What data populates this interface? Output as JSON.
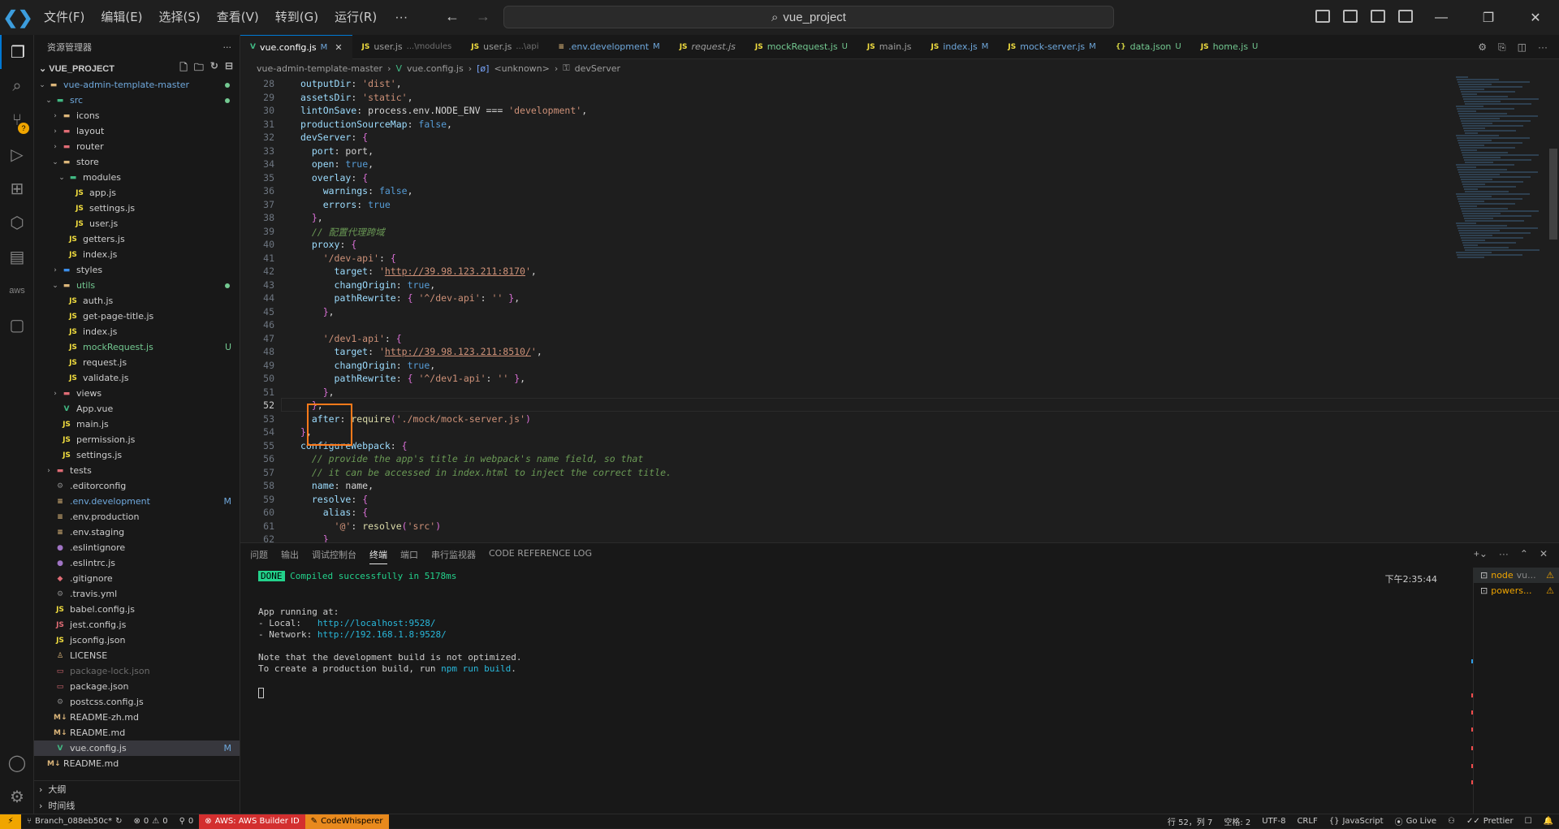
{
  "menu": {
    "items": [
      "文件(F)",
      "编辑(E)",
      "选择(S)",
      "查看(V)",
      "转到(G)",
      "运行(R)"
    ],
    "more": "···"
  },
  "search": {
    "text": "vue_project"
  },
  "window": {
    "min": "—",
    "max": "❐",
    "close": "✕"
  },
  "explorer": {
    "title": "资源管理器",
    "more": "···",
    "project": "VUE_PROJECT",
    "rows": [
      {
        "depth": 1,
        "chev": "⌄",
        "icon": "▬",
        "ic": "fold",
        "name": "vue-admin-template-master",
        "cls": "git-m",
        "stat": "dot"
      },
      {
        "depth": 2,
        "chev": "⌄",
        "icon": "▬",
        "ic": "vue",
        "name": "src",
        "cls": "git-m",
        "stat": "dot"
      },
      {
        "depth": 3,
        "chev": "›",
        "icon": "▬",
        "ic": "fold",
        "name": "icons",
        "cls": "",
        "stat": ""
      },
      {
        "depth": 3,
        "chev": "›",
        "icon": "▬",
        "ic": "red",
        "name": "layout",
        "cls": "",
        "stat": ""
      },
      {
        "depth": 3,
        "chev": "›",
        "icon": "▬",
        "ic": "red",
        "name": "router",
        "cls": "",
        "stat": ""
      },
      {
        "depth": 3,
        "chev": "⌄",
        "icon": "▬",
        "ic": "fold",
        "name": "store",
        "cls": "",
        "stat": ""
      },
      {
        "depth": 4,
        "chev": "⌄",
        "icon": "▬",
        "ic": "vue",
        "name": "modules",
        "cls": "",
        "stat": ""
      },
      {
        "depth": 5,
        "chev": "",
        "icon": "JS",
        "ic": "js",
        "name": "app.js",
        "cls": "",
        "stat": ""
      },
      {
        "depth": 5,
        "chev": "",
        "icon": "JS",
        "ic": "js",
        "name": "settings.js",
        "cls": "",
        "stat": ""
      },
      {
        "depth": 5,
        "chev": "",
        "icon": "JS",
        "ic": "js",
        "name": "user.js",
        "cls": "",
        "stat": ""
      },
      {
        "depth": 4,
        "chev": "",
        "icon": "JS",
        "ic": "js",
        "name": "getters.js",
        "cls": "",
        "stat": ""
      },
      {
        "depth": 4,
        "chev": "",
        "icon": "JS",
        "ic": "js",
        "name": "index.js",
        "cls": "",
        "stat": ""
      },
      {
        "depth": 3,
        "chev": "›",
        "icon": "▬",
        "ic": "blue",
        "name": "styles",
        "cls": "",
        "stat": ""
      },
      {
        "depth": 3,
        "chev": "⌄",
        "icon": "▬",
        "ic": "fold",
        "name": "utils",
        "cls": "git-u",
        "stat": "dot"
      },
      {
        "depth": 4,
        "chev": "",
        "icon": "JS",
        "ic": "js",
        "name": "auth.js",
        "cls": "",
        "stat": ""
      },
      {
        "depth": 4,
        "chev": "",
        "icon": "JS",
        "ic": "js",
        "name": "get-page-title.js",
        "cls": "",
        "stat": ""
      },
      {
        "depth": 4,
        "chev": "",
        "icon": "JS",
        "ic": "js",
        "name": "index.js",
        "cls": "",
        "stat": ""
      },
      {
        "depth": 4,
        "chev": "",
        "icon": "JS",
        "ic": "js",
        "name": "mockRequest.js",
        "cls": "git-u",
        "stat": "U"
      },
      {
        "depth": 4,
        "chev": "",
        "icon": "JS",
        "ic": "js",
        "name": "request.js",
        "cls": "",
        "stat": ""
      },
      {
        "depth": 4,
        "chev": "",
        "icon": "JS",
        "ic": "js",
        "name": "validate.js",
        "cls": "",
        "stat": ""
      },
      {
        "depth": 3,
        "chev": "›",
        "icon": "▬",
        "ic": "red",
        "name": "views",
        "cls": "",
        "stat": ""
      },
      {
        "depth": 3,
        "chev": "",
        "icon": "V",
        "ic": "vue",
        "name": "App.vue",
        "cls": "",
        "stat": ""
      },
      {
        "depth": 3,
        "chev": "",
        "icon": "JS",
        "ic": "js",
        "name": "main.js",
        "cls": "",
        "stat": ""
      },
      {
        "depth": 3,
        "chev": "",
        "icon": "JS",
        "ic": "js",
        "name": "permission.js",
        "cls": "",
        "stat": ""
      },
      {
        "depth": 3,
        "chev": "",
        "icon": "JS",
        "ic": "js",
        "name": "settings.js",
        "cls": "",
        "stat": ""
      },
      {
        "depth": 2,
        "chev": "›",
        "icon": "▬",
        "ic": "red",
        "name": "tests",
        "cls": "",
        "stat": ""
      },
      {
        "depth": 2,
        "chev": "",
        "icon": "⚙",
        "ic": "gray",
        "name": ".editorconfig",
        "cls": "",
        "stat": ""
      },
      {
        "depth": 2,
        "chev": "",
        "icon": "≡",
        "ic": "fold",
        "name": ".env.development",
        "cls": "git-m",
        "stat": "M"
      },
      {
        "depth": 2,
        "chev": "",
        "icon": "≡",
        "ic": "fold",
        "name": ".env.production",
        "cls": "",
        "stat": ""
      },
      {
        "depth": 2,
        "chev": "",
        "icon": "≡",
        "ic": "fold",
        "name": ".env.staging",
        "cls": "",
        "stat": ""
      },
      {
        "depth": 2,
        "chev": "",
        "icon": "●",
        "ic": "purp",
        "name": ".eslintignore",
        "cls": "",
        "stat": ""
      },
      {
        "depth": 2,
        "chev": "",
        "icon": "●",
        "ic": "purp",
        "name": ".eslintrc.js",
        "cls": "",
        "stat": ""
      },
      {
        "depth": 2,
        "chev": "",
        "icon": "◆",
        "ic": "red",
        "name": ".gitignore",
        "cls": "",
        "stat": ""
      },
      {
        "depth": 2,
        "chev": "",
        "icon": "⚙",
        "ic": "gray",
        "name": ".travis.yml",
        "cls": "",
        "stat": ""
      },
      {
        "depth": 2,
        "chev": "",
        "icon": "JS",
        "ic": "js",
        "name": "babel.config.js",
        "cls": "",
        "stat": ""
      },
      {
        "depth": 2,
        "chev": "",
        "icon": "JS",
        "ic": "red",
        "name": "jest.config.js",
        "cls": "",
        "stat": ""
      },
      {
        "depth": 2,
        "chev": "",
        "icon": "JS",
        "ic": "js",
        "name": "jsconfig.json",
        "cls": "",
        "stat": ""
      },
      {
        "depth": 2,
        "chev": "",
        "icon": "♙",
        "ic": "fold",
        "name": "LICENSE",
        "cls": "",
        "stat": ""
      },
      {
        "depth": 2,
        "chev": "",
        "icon": "▭",
        "ic": "red",
        "name": "package-lock.json",
        "cls": "ign",
        "stat": ""
      },
      {
        "depth": 2,
        "chev": "",
        "icon": "▭",
        "ic": "red",
        "name": "package.json",
        "cls": "",
        "stat": ""
      },
      {
        "depth": 2,
        "chev": "",
        "icon": "⚙",
        "ic": "gray",
        "name": "postcss.config.js",
        "cls": "",
        "stat": ""
      },
      {
        "depth": 2,
        "chev": "",
        "icon": "M↓",
        "ic": "fold",
        "name": "README-zh.md",
        "cls": "",
        "stat": ""
      },
      {
        "depth": 2,
        "chev": "",
        "icon": "M↓",
        "ic": "fold",
        "name": "README.md",
        "cls": "",
        "stat": ""
      },
      {
        "depth": 2,
        "chev": "",
        "icon": "V",
        "ic": "vue",
        "name": "vue.config.js",
        "cls": "sel",
        "stat": "M"
      },
      {
        "depth": 1,
        "chev": "",
        "icon": "M↓",
        "ic": "fold",
        "name": "README.md",
        "cls": "",
        "stat": ""
      }
    ],
    "outline": "大纲",
    "timeline": "时间线"
  },
  "tabs": [
    {
      "icon": "V",
      "ic": "vue",
      "name": "vue.config.js",
      "desc": "",
      "st": "M",
      "active": true
    },
    {
      "icon": "JS",
      "ic": "js",
      "name": "user.js",
      "desc": "...\\modules",
      "st": "",
      "active": false
    },
    {
      "icon": "JS",
      "ic": "js",
      "name": "user.js",
      "desc": "...\\api",
      "st": "",
      "active": false
    },
    {
      "icon": "≡",
      "ic": "fold",
      "name": ".env.development",
      "desc": "",
      "st": "M",
      "active": false
    },
    {
      "icon": "JS",
      "ic": "js",
      "name": "request.js",
      "desc": "",
      "st": "",
      "active": false
    },
    {
      "icon": "JS",
      "ic": "js",
      "name": "mockRequest.js",
      "desc": "",
      "st": "U",
      "active": false
    },
    {
      "icon": "JS",
      "ic": "js",
      "name": "main.js",
      "desc": "",
      "st": "",
      "active": false
    },
    {
      "icon": "JS",
      "ic": "js",
      "name": "index.js",
      "desc": "",
      "st": "M",
      "active": false
    },
    {
      "icon": "JS",
      "ic": "js",
      "name": "mock-server.js",
      "desc": "",
      "st": "M",
      "active": false
    },
    {
      "icon": "{}",
      "ic": "json",
      "name": "data.json",
      "desc": "",
      "st": "U",
      "active": false
    },
    {
      "icon": "JS",
      "ic": "js",
      "name": "home.js",
      "desc": "",
      "st": "U",
      "active": false
    }
  ],
  "breadcrumb": [
    "vue-admin-template-master",
    "vue.config.js",
    "<unknown>",
    "devServer"
  ],
  "code": [
    {
      "n": "28",
      "t": "outputDir: 'dist',"
    },
    {
      "n": "29",
      "t": "assetsDir: 'static',"
    },
    {
      "n": "30",
      "t": "lintOnSave: process.env.NODE_ENV === 'development',"
    },
    {
      "n": "31",
      "t": "productionSourceMap: false,"
    },
    {
      "n": "32",
      "t": "devServer: {"
    },
    {
      "n": "33",
      "t": "  port: port,"
    },
    {
      "n": "34",
      "t": "  open: true,"
    },
    {
      "n": "35",
      "t": "  overlay: {"
    },
    {
      "n": "36",
      "t": "    warnings: false,"
    },
    {
      "n": "37",
      "t": "    errors: true"
    },
    {
      "n": "38",
      "t": "  },"
    },
    {
      "n": "39",
      "t": "  // 配置代理跨域"
    },
    {
      "n": "40",
      "t": "  proxy: {"
    },
    {
      "n": "41",
      "t": "    '/dev-api': {"
    },
    {
      "n": "42",
      "t": "      target: 'http://39.98.123.211:8170',"
    },
    {
      "n": "43",
      "t": "      changOrigin: true,"
    },
    {
      "n": "44",
      "t": "      pathRewrite: { '^/dev-api': '' },"
    },
    {
      "n": "45",
      "t": "    },"
    },
    {
      "n": "46",
      "t": ""
    },
    {
      "n": "47",
      "t": "    '/dev1-api': {"
    },
    {
      "n": "48",
      "t": "      target: 'http://39.98.123.211:8510/',"
    },
    {
      "n": "49",
      "t": "      changOrigin: true,"
    },
    {
      "n": "50",
      "t": "      pathRewrite: { '^/dev1-api': '' },"
    },
    {
      "n": "51",
      "t": "    },"
    },
    {
      "n": "52",
      "t": "  },"
    },
    {
      "n": "53",
      "t": "  after: require('./mock/mock-server.js')"
    },
    {
      "n": "54",
      "t": "},"
    },
    {
      "n": "55",
      "t": "configureWebpack: {"
    },
    {
      "n": "56",
      "t": "  // provide the app's title in webpack's name field, so that"
    },
    {
      "n": "57",
      "t": "  // it can be accessed in index.html to inject the correct title."
    },
    {
      "n": "58",
      "t": "  name: name,"
    },
    {
      "n": "59",
      "t": "  resolve: {"
    },
    {
      "n": "60",
      "t": "    alias: {"
    },
    {
      "n": "61",
      "t": "      '@': resolve('src')"
    },
    {
      "n": "62",
      "t": "    }"
    }
  ],
  "panel": {
    "tabs": [
      "问题",
      "输出",
      "调试控制台",
      "终端",
      "端口",
      "串行监视器",
      "CODE REFERENCE LOG"
    ],
    "time": "下午2:35:44",
    "done": "DONE",
    "compiled": "Compiled successfully in 5178ms",
    "running": "App running at:",
    "local_label": "- Local:   ",
    "local_url": "http://localhost:9528/",
    "network_label": "- Network: ",
    "network_url": "http://192.168.1.8:9528/",
    "note": "Note that the development build is not optimized.",
    "prod_pre": "To create a production build, run ",
    "prod_cmd": "npm run build",
    "prod_post": ".",
    "terminals": [
      {
        "name": "node",
        "desc": "vu..."
      },
      {
        "name": "powers...",
        "desc": ""
      }
    ]
  },
  "status": {
    "remote": "⚡",
    "branch": "Branch_088eb50c*",
    "errors": "0",
    "warnings": "0",
    "ports": "0",
    "aws": "AWS: AWS Builder ID",
    "cw": "CodeWhisperer",
    "position": "行 52，列 7",
    "spaces": "空格: 2",
    "encoding": "UTF-8",
    "eol": "CRLF",
    "language": "JavaScript",
    "golive": "Go Live",
    "prettier": "Prettier"
  }
}
